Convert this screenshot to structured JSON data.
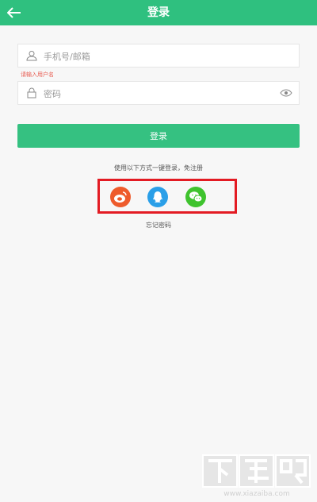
{
  "header": {
    "title": "登录",
    "back_icon": "arrow-left-icon"
  },
  "form": {
    "account": {
      "placeholder": "手机号/邮箱",
      "value": "",
      "icon": "user-icon"
    },
    "error_text": "请输入用户名",
    "password": {
      "placeholder": "密码",
      "value": "",
      "icon": "lock-icon",
      "toggle_icon": "eye-icon"
    },
    "login_label": "登录"
  },
  "social": {
    "hint": "使用以下方式一键登录，免注册",
    "providers": [
      {
        "name": "weibo",
        "icon": "weibo-icon",
        "color": "#ee5b2c"
      },
      {
        "name": "qq",
        "icon": "qq-icon",
        "color": "#2a9fe8"
      },
      {
        "name": "wechat",
        "icon": "wechat-icon",
        "color": "#3fc32e"
      }
    ],
    "highlight_color": "#e31b23"
  },
  "forgot_label": "忘记密码",
  "watermark": {
    "text": "下载吧",
    "url": "www.xiazaiba.com"
  },
  "colors": {
    "primary": "#2fc07f",
    "error": "#e85a4f"
  }
}
